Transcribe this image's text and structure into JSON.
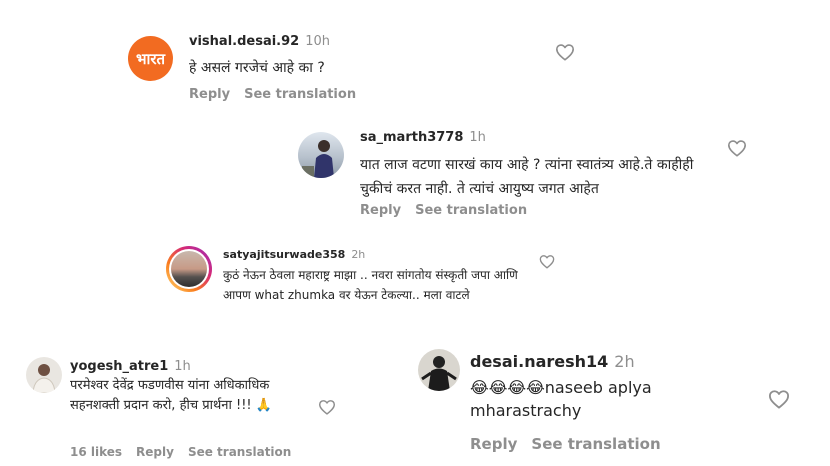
{
  "comments": [
    {
      "username": "vishal.desai.92",
      "time": "10h",
      "text": "हे असलं गरजेचं आहे का ?",
      "reply_label": "Reply",
      "translate_label": "See translation",
      "avatar_text": "भारत"
    },
    {
      "username": "sa_marth3778",
      "time": "1h",
      "text": "यात लाज वटणा सारखं काय आहे ? त्यांना स्वातंत्र्य आहे.ते काहीही चुकीचं करत नाही. ते त्यांचं आयुष्य जगत आहेत",
      "reply_label": "Reply",
      "translate_label": "See translation"
    },
    {
      "username": "satyajitsurwade358",
      "time": "2h",
      "text": "कुठं नेऊन ठेवला महाराष्ट्र माझा .. नवरा सांगतोय संस्कृती जपा आणि आपण what zhumka वर येऊन टेकल्या.. मला वाटले"
    },
    {
      "username": "yogesh_atre1",
      "time": "1h",
      "text": "परमेश्वर देवेंद्र फडणवीस यांना अधिकाधिक सहनशक्ती प्रदान करो, हीच प्रार्थना !!! 🙏",
      "likes_label": "16 likes",
      "reply_label": "Reply",
      "translate_label": "See translation"
    },
    {
      "username": "desai.naresh14",
      "time": "2h",
      "text": "😂😂😂😂naseeb aplya mharastrachy",
      "reply_label": "Reply",
      "translate_label": "See translation"
    }
  ],
  "colors": {
    "text": "#262626",
    "muted": "#8e8e8e",
    "story_ring": "#d62976",
    "bharat_orange": "#f26b21"
  },
  "icons": [
    "heart-icon"
  ]
}
